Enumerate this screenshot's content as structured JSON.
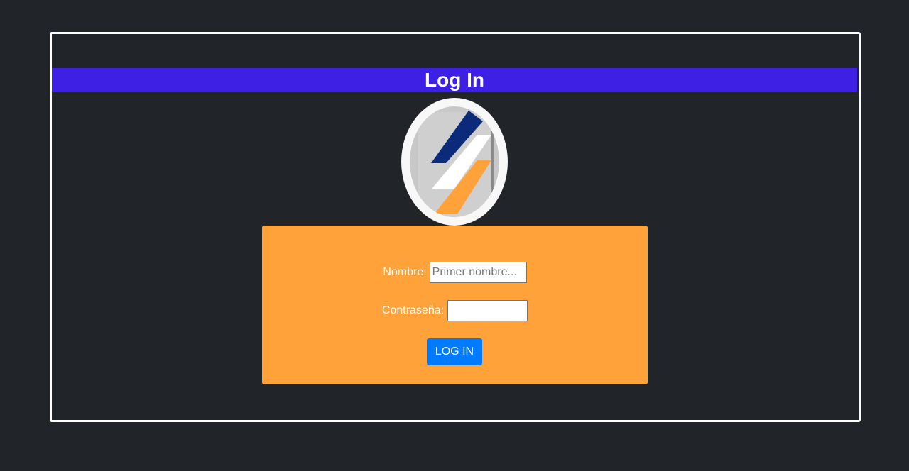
{
  "header": {
    "title": "Log In"
  },
  "logo": {
    "icon": "company-logo-icon",
    "colors": {
      "ring": "#f8f8f8",
      "inner": "#c8c8c8",
      "stripe_top": "#0b2a7a",
      "stripe_mid": "#ffffff",
      "stripe_bottom": "#ffa23a"
    }
  },
  "form": {
    "nombre_label": "Nombre:",
    "nombre_placeholder": "Primer nombre...",
    "nombre_value": "",
    "password_label": "Contraseña:",
    "password_value": "",
    "submit_label": "LOG IN"
  },
  "colors": {
    "background": "#212529",
    "title_bar": "#3e20e4",
    "panel": "#ffa23a",
    "button": "#007bff"
  }
}
